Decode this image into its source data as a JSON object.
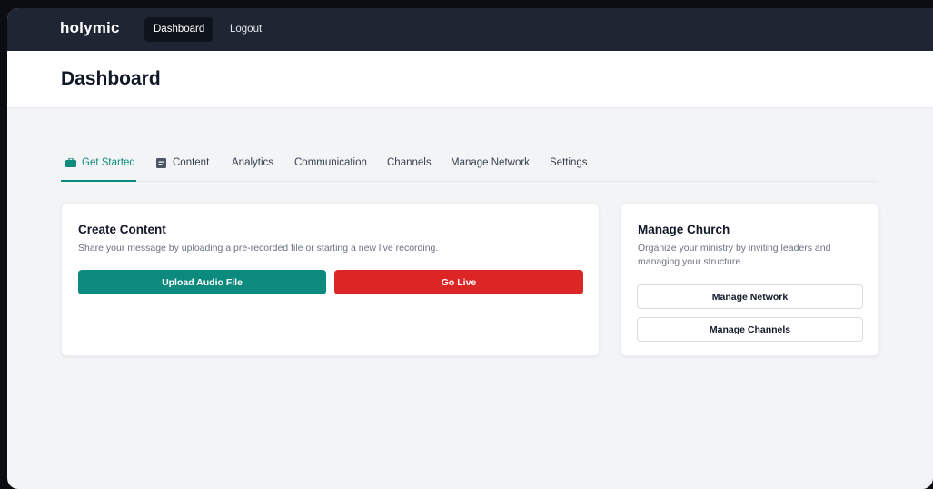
{
  "topbar": {
    "brand": "holymic",
    "nav": [
      {
        "label": "Dashboard"
      },
      {
        "label": "Logout"
      }
    ]
  },
  "header": {
    "title": "Dashboard"
  },
  "tabs": [
    {
      "label": "Get Started",
      "icon": "briefcase-icon"
    },
    {
      "label": "Content",
      "icon": "document-icon"
    },
    {
      "label": "Analytics"
    },
    {
      "label": "Communication"
    },
    {
      "label": "Channels"
    },
    {
      "label": "Manage Network"
    },
    {
      "label": "Settings"
    }
  ],
  "create_card": {
    "title": "Create Content",
    "description": "Share your message by uploading a pre-recorded file or starting a new live recording.",
    "upload_label": "Upload Audio File",
    "live_label": "Go Live"
  },
  "manage_card": {
    "title": "Manage Church",
    "description": "Organize your ministry by inviting leaders and managing your structure.",
    "network_label": "Manage Network",
    "channels_label": "Manage Channels"
  },
  "colors": {
    "accent": "#0d8a7e",
    "danger": "#dc2626",
    "topbar": "#1e2533"
  }
}
